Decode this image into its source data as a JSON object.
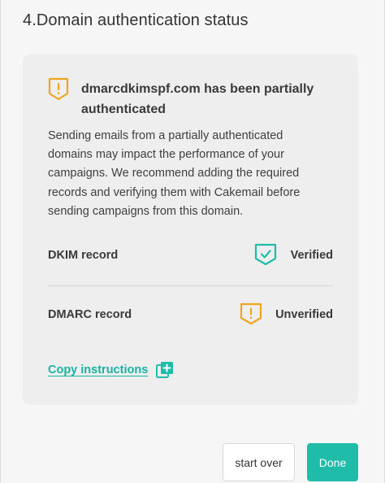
{
  "section": {
    "title": "4.Domain authentication status"
  },
  "alert": {
    "title": "dmarcdkimspf.com has been partially authenticated",
    "body": "Sending emails from a partially authenticated domains may impact the performance of your campaigns. We recommend adding the required records and verifying them with Cakemail before sending campaigns from this domain."
  },
  "records": [
    {
      "label": "DKIM record",
      "status": "Verified",
      "icon": "check-shield-icon"
    },
    {
      "label": "DMARC record",
      "status": "Unverified",
      "icon": "warning-shield-icon"
    }
  ],
  "copy": {
    "label": "Copy instructions"
  },
  "buttons": {
    "start_over": "start over",
    "done": "Done"
  },
  "colors": {
    "warning": "#f0a51e",
    "accent": "#1fbcaa",
    "link": "#17b3a3"
  }
}
